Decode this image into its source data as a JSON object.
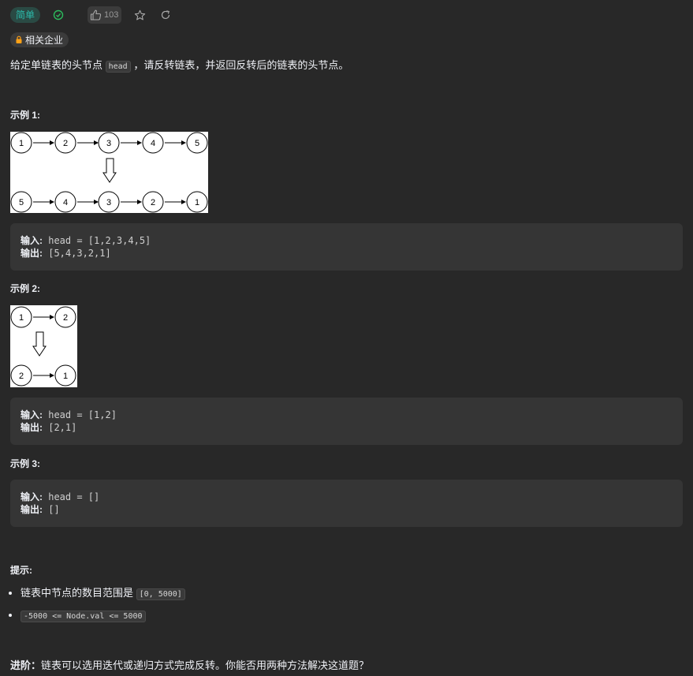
{
  "toolbar": {
    "difficulty": "简单",
    "likes": "103",
    "difficulty_color": "#2cbbac",
    "solved_icon": "check-circle-icon",
    "like_icon": "thumbs-up-icon",
    "star_icon": "star-icon",
    "share_icon": "refresh-icon"
  },
  "tag": {
    "label": "相关企业",
    "icon": "lock-icon"
  },
  "description": {
    "before": "给定单链表的头节点 ",
    "code": "head",
    "after": " ，请反转链表，并返回反转后的链表的头节点。"
  },
  "examples": [
    {
      "title": "示例 1:",
      "diagram": {
        "top": [
          "1",
          "2",
          "3",
          "4",
          "5"
        ],
        "bottom": [
          "5",
          "4",
          "3",
          "2",
          "1"
        ]
      },
      "input_label": "输入:",
      "input_value": " head = [1,2,3,4,5]",
      "output_label": "输出:",
      "output_value": " [5,4,3,2,1]"
    },
    {
      "title": "示例 2:",
      "diagram": {
        "top": [
          "1",
          "2"
        ],
        "bottom": [
          "2",
          "1"
        ]
      },
      "input_label": "输入:",
      "input_value": " head = [1,2]",
      "output_label": "输出:",
      "output_value": " [2,1]"
    },
    {
      "title": "示例 3:",
      "input_label": "输入:",
      "input_value": " head = []",
      "output_label": "输出:",
      "output_value": " []"
    }
  ],
  "constraints": {
    "title": "提示:",
    "items": [
      {
        "text": "链表中节点的数目范围是 ",
        "code": "[0, 5000]"
      },
      {
        "text": "",
        "code": "-5000 <= Node.val <= 5000"
      }
    ]
  },
  "followup": {
    "label": "进阶：",
    "text": "链表可以选用迭代或递归方式完成反转。你能否用两种方法解决这道题？"
  }
}
